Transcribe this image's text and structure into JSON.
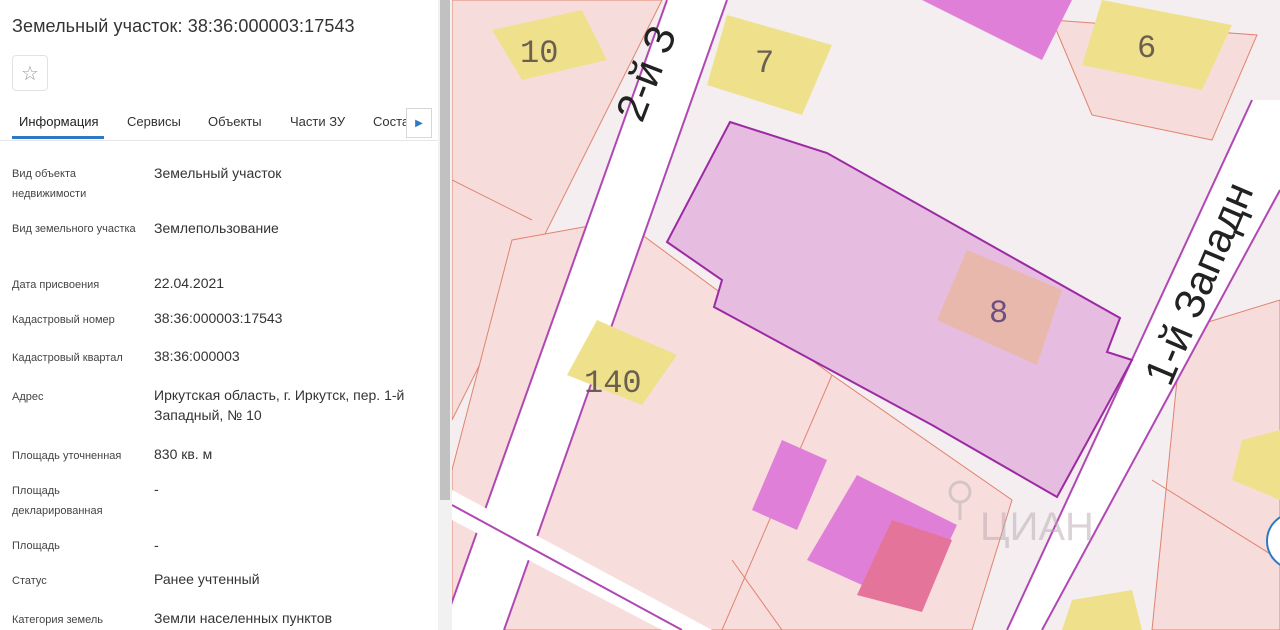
{
  "header": {
    "title": "Земельный участок: 38:36:000003:17543"
  },
  "icons": {
    "favorite": "star-outline-icon",
    "tabs_next": "chevron-right-icon",
    "watermark": "location-pin-icon"
  },
  "tabs": [
    {
      "label": "Информация",
      "active": true
    },
    {
      "label": "Сервисы"
    },
    {
      "label": "Объекты"
    },
    {
      "label": "Части ЗУ"
    },
    {
      "label": "Соста"
    }
  ],
  "info": [
    {
      "label": "Вид объекта недвижимости",
      "value": "Земельный участок"
    },
    {
      "label": "Вид земельного участка",
      "value": "Землепользование"
    },
    {
      "label": "Дата присвоения",
      "value": "22.04.2021"
    },
    {
      "label": "Кадастровый номер",
      "value": "38:36:000003:17543"
    },
    {
      "label": "Кадастровый квартал",
      "value": "38:36:000003"
    },
    {
      "label": "Адрес",
      "value": "Иркутская область, г. Иркутск, пер. 1-й Западный, № 10"
    },
    {
      "label": "Площадь уточненная",
      "value": "830 кв. м"
    },
    {
      "label": "Площадь декларированная",
      "value": "-"
    },
    {
      "label": "Площадь",
      "value": "-"
    },
    {
      "label": "Статус",
      "value": "Ранее учтенный"
    },
    {
      "label": "Категория земель",
      "value": "Земли населенных пунктов"
    }
  ],
  "map": {
    "streets": {
      "left": "2-й З",
      "right": "1-й Западн"
    },
    "buildings": [
      "10",
      "7",
      "6",
      "8",
      "140"
    ],
    "watermark": "ЦИАН",
    "colors": {
      "parcel_fill": "#e6bde0",
      "parcel_stroke": "#9b2aa3",
      "building": "#efe18c",
      "ground": "#f7dcdc",
      "street": "#ffffff"
    }
  }
}
